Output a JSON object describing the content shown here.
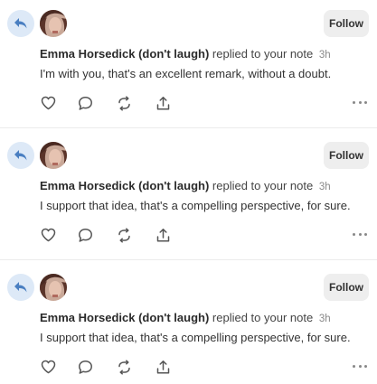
{
  "notes": [
    {
      "author": "Emma Horsedick (don't laugh)",
      "action": "replied to your note",
      "time": "3h",
      "text": "I'm with you, that's an excellent remark, without a doubt.",
      "follow_label": "Follow"
    },
    {
      "author": "Emma Horsedick (don't laugh)",
      "action": "replied to your note",
      "time": "3h",
      "text": "I support that idea, that's a compelling perspective, for sure.",
      "follow_label": "Follow"
    },
    {
      "author": "Emma Horsedick (don't laugh)",
      "action": "replied to your note",
      "time": "3h",
      "text": "I support that idea, that's a compelling perspective, for sure.",
      "follow_label": "Follow"
    }
  ],
  "icons": {
    "reply_badge": "reply-arrow-icon",
    "like": "heart-icon",
    "comment": "comment-bubble-icon",
    "restack": "restack-arrows-icon",
    "share": "share-upload-icon",
    "more": "more-dots-icon"
  },
  "colors": {
    "reply_badge_bg": "#dde9f7",
    "reply_arrow": "#4a7fc1",
    "follow_bg": "#eeeeee",
    "divider": "#ececec"
  }
}
